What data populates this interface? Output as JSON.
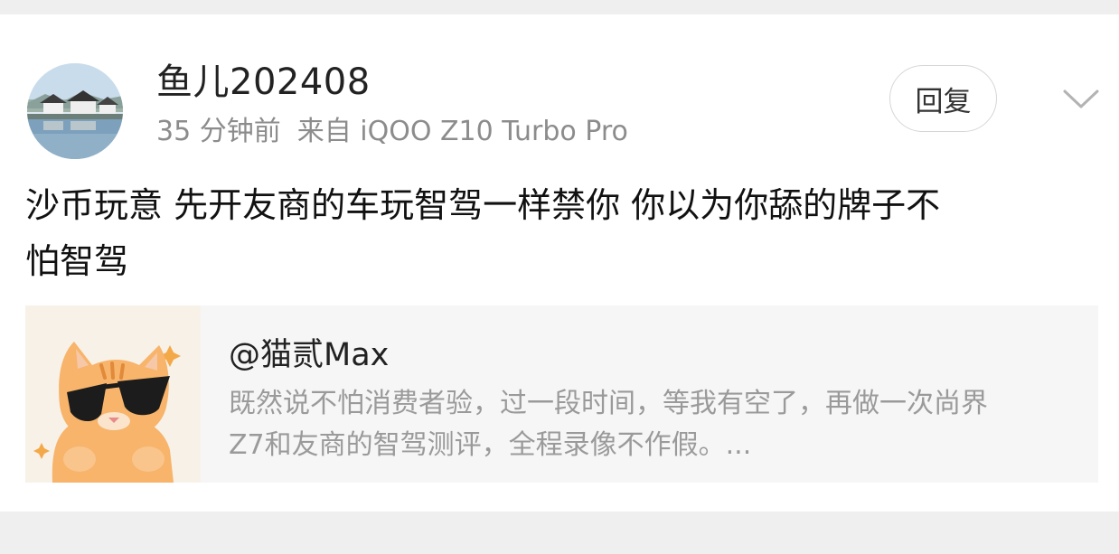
{
  "post": {
    "username": "鱼儿202408",
    "time": "35 分钟前",
    "source": "来自 iQOO Z10 Turbo Pro",
    "reply_label": "回复",
    "content_line1": "沙币玩意 先开友商的车玩智驾一样禁你 你以为你舔的牌子不",
    "content_line2": "怕智驾"
  },
  "quote": {
    "author": "@猫贰Max",
    "line1": "既然说不怕消费者验，过一段时间，等我有空了，再做一次尚界",
    "line2": "Z7和友商的智驾测评，全程录像不作假。..."
  },
  "icons": {
    "more": "chevron-down-icon"
  },
  "colors": {
    "background": "#efefef",
    "card": "#ffffff",
    "quote_bg": "#f6f6f6",
    "muted_text": "#8c8c8c"
  }
}
